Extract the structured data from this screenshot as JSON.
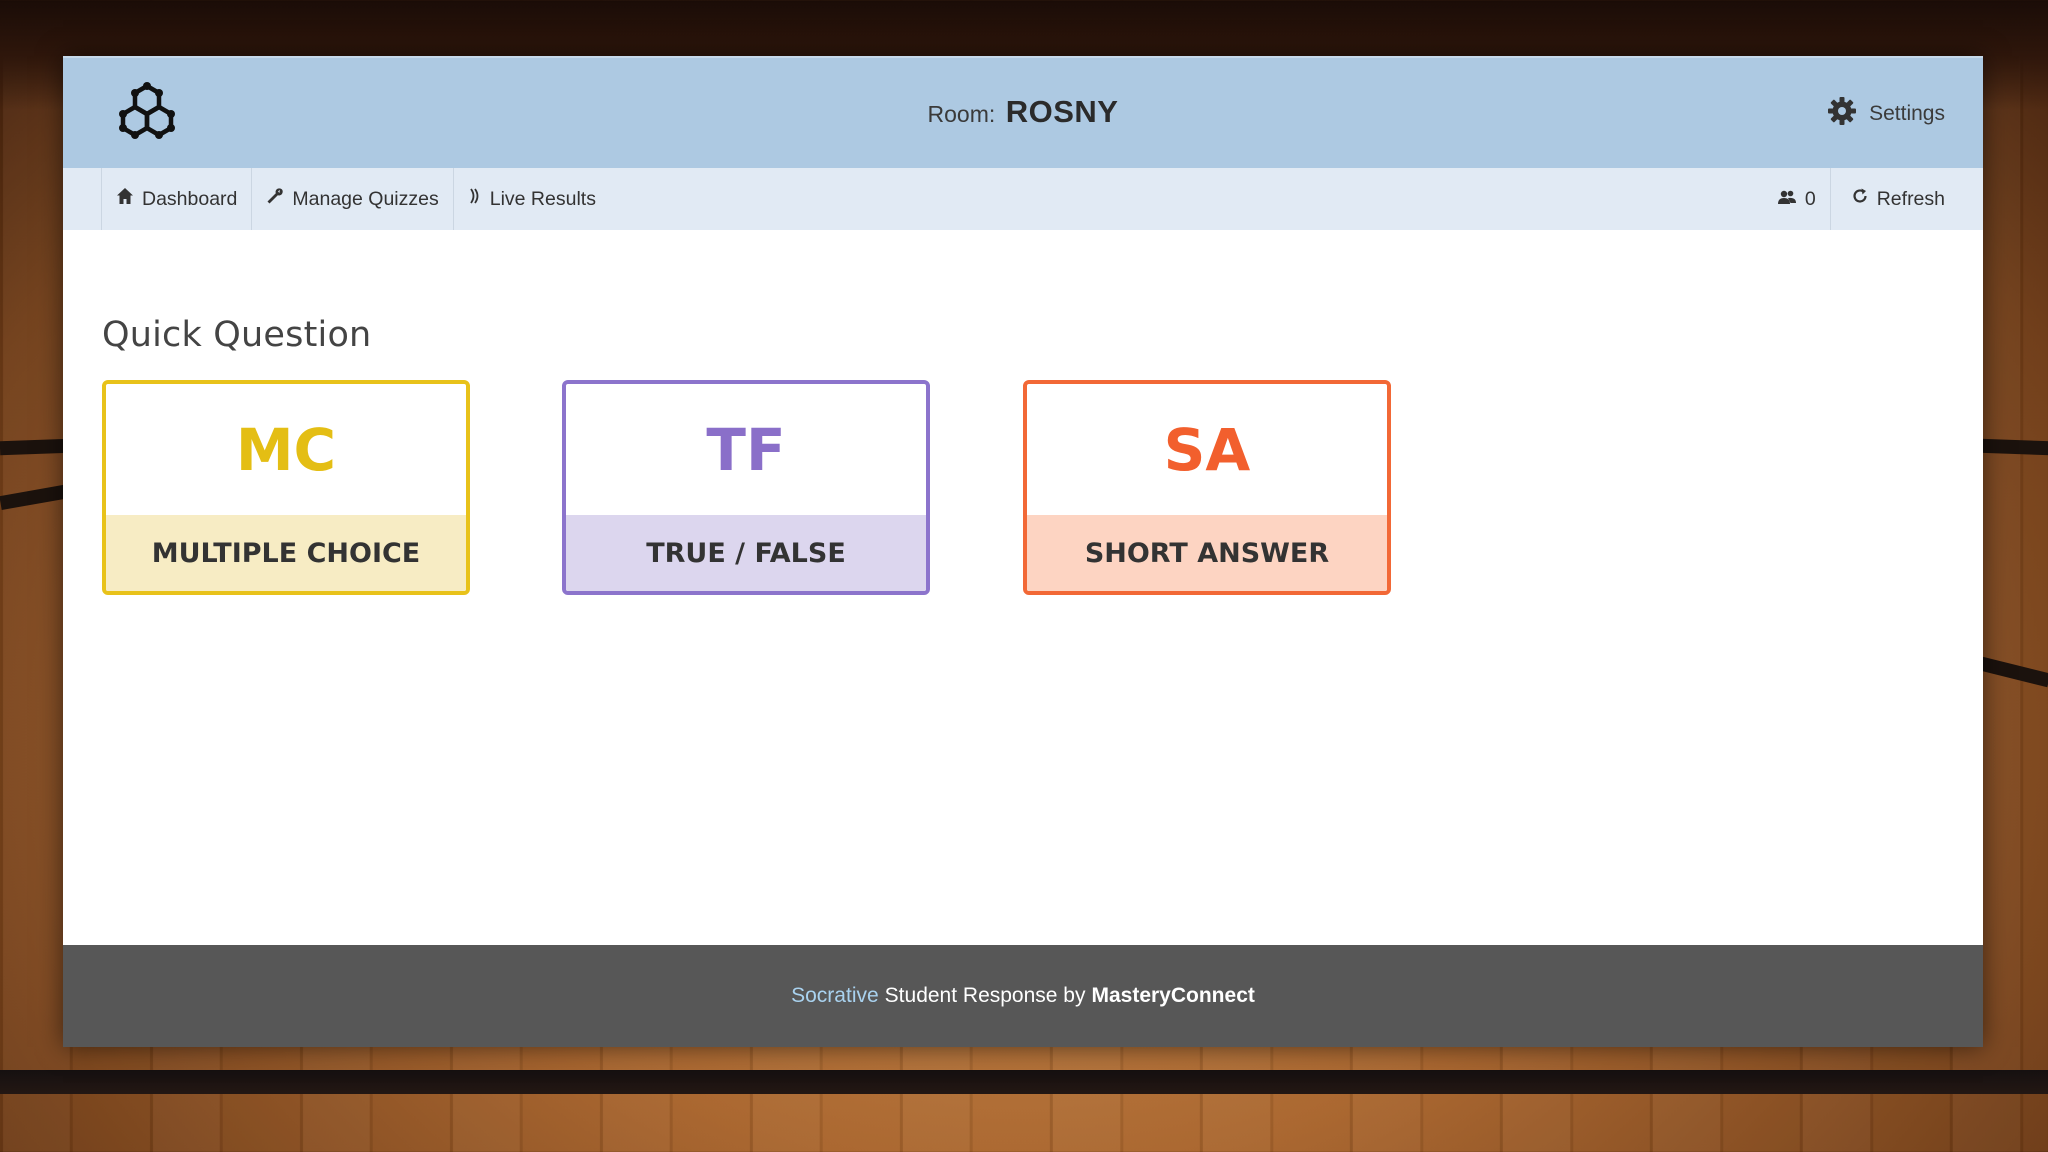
{
  "header": {
    "room_label": "Room:",
    "room_name": "ROSNY",
    "settings_label": "Settings"
  },
  "nav": {
    "items": [
      {
        "label": "Dashboard",
        "icon": "home-icon"
      },
      {
        "label": "Manage Quizzes",
        "icon": "wrench-icon"
      },
      {
        "label": "Live Results",
        "icon": "live-results-icon"
      }
    ],
    "student_count": "0",
    "refresh_label": "Refresh"
  },
  "main": {
    "section_title": "Quick Question",
    "cards": [
      {
        "abbr": "MC",
        "label": "MULTIPLE CHOICE",
        "accent": "#e8c21a"
      },
      {
        "abbr": "TF",
        "label": "TRUE / FALSE",
        "accent": "#8c74cc"
      },
      {
        "abbr": "SA",
        "label": "SHORT ANSWER",
        "accent": "#f26836"
      }
    ]
  },
  "footer": {
    "brand": "Socrative",
    "middle": "Student Response by",
    "company": "MasteryConnect"
  },
  "colors": {
    "header_bg": "#adc9e2",
    "subnav_bg": "#e1eaf4",
    "footer_bg": "#575757"
  }
}
